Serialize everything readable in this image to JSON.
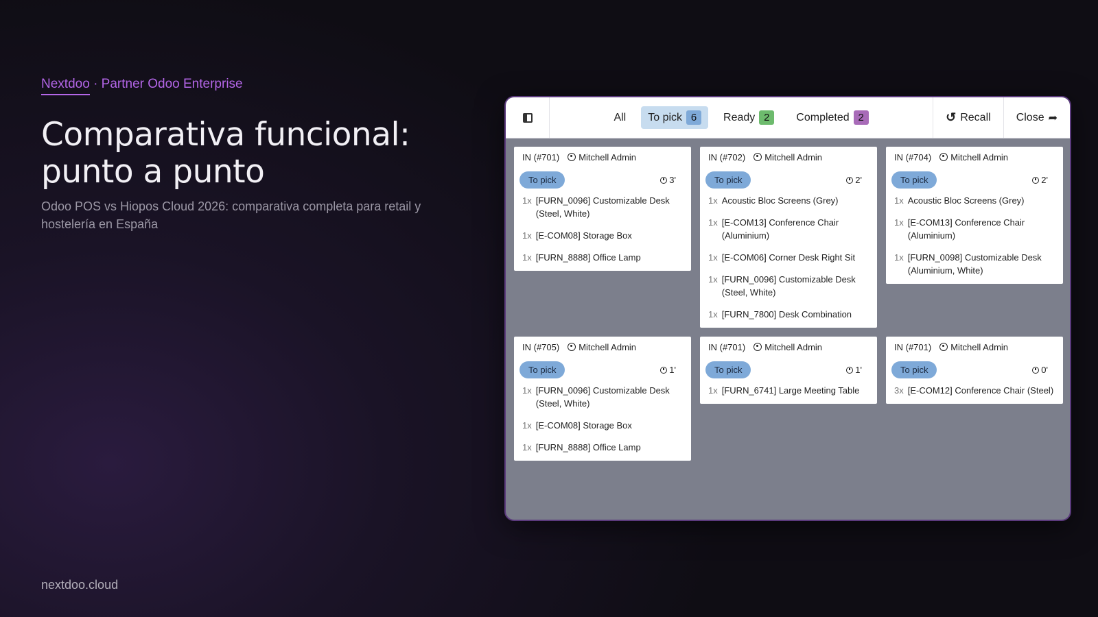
{
  "brand": {
    "name": "Nextdoo",
    "tagline": "· Partner Odoo Enterprise"
  },
  "title": "Comparativa funcional: punto a punto",
  "subtitle": "Odoo POS vs Hiopos Cloud 2026: comparativa completa para retail y hostelería en España",
  "footer": "nextdoo.cloud",
  "toolbar": {
    "tabs": [
      {
        "label": "All",
        "count": "",
        "active": false,
        "color": ""
      },
      {
        "label": "To pick",
        "count": "6",
        "active": true,
        "color": "#7ea9d8"
      },
      {
        "label": "Ready",
        "count": "2",
        "active": false,
        "color": "#6dbb6d"
      },
      {
        "label": "Completed",
        "count": "2",
        "active": false,
        "color": "#a86bb8"
      }
    ],
    "recall": "Recall",
    "close": "Close"
  },
  "cards": [
    {
      "ref": "IN (#701)",
      "user": "Mitchell Admin",
      "status": "To pick",
      "time": "3'",
      "lines": [
        {
          "qty": "1x",
          "name": "[FURN_0096] Customizable Desk (Steel, White)"
        },
        {
          "qty": "1x",
          "name": "[E-COM08] Storage Box"
        },
        {
          "qty": "1x",
          "name": "[FURN_8888] Office Lamp"
        }
      ]
    },
    {
      "ref": "IN (#702)",
      "user": "Mitchell Admin",
      "status": "To pick",
      "time": "2'",
      "lines": [
        {
          "qty": "1x",
          "name": "Acoustic Bloc Screens (Grey)"
        },
        {
          "qty": "1x",
          "name": "[E-COM13] Conference Chair (Aluminium)"
        },
        {
          "qty": "1x",
          "name": "[E-COM06] Corner Desk Right Sit"
        },
        {
          "qty": "1x",
          "name": "[FURN_0096] Customizable Desk (Steel, White)"
        },
        {
          "qty": "1x",
          "name": "[FURN_7800] Desk Combination"
        }
      ]
    },
    {
      "ref": "IN (#704)",
      "user": "Mitchell Admin",
      "status": "To pick",
      "time": "2'",
      "lines": [
        {
          "qty": "1x",
          "name": "Acoustic Bloc Screens (Grey)"
        },
        {
          "qty": "1x",
          "name": "[E-COM13] Conference Chair (Aluminium)"
        },
        {
          "qty": "1x",
          "name": "[FURN_0098] Customizable Desk (Aluminium, White)"
        }
      ]
    },
    {
      "ref": "IN (#705)",
      "user": "Mitchell Admin",
      "status": "To pick",
      "time": "1'",
      "lines": [
        {
          "qty": "1x",
          "name": "[FURN_0096] Customizable Desk (Steel, White)"
        },
        {
          "qty": "1x",
          "name": "[E-COM08] Storage Box"
        },
        {
          "qty": "1x",
          "name": "[FURN_8888] Office Lamp"
        }
      ]
    },
    {
      "ref": "IN (#701)",
      "user": "Mitchell Admin",
      "status": "To pick",
      "time": "1'",
      "lines": [
        {
          "qty": "1x",
          "name": "[FURN_6741] Large Meeting Table"
        }
      ]
    },
    {
      "ref": "IN (#701)",
      "user": "Mitchell Admin",
      "status": "To pick",
      "time": "0'",
      "lines": [
        {
          "qty": "3x",
          "name": "[E-COM12] Conference Chair (Steel)"
        }
      ]
    }
  ]
}
